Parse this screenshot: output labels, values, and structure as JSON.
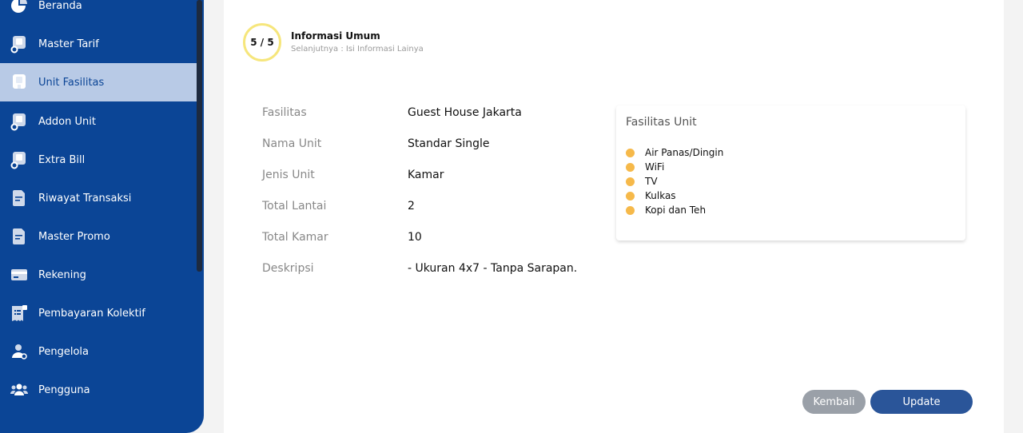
{
  "sidebar": {
    "items": [
      {
        "label": "Beranda",
        "icon": "pie-chart-icon"
      },
      {
        "label": "Master Tarif",
        "icon": "building-settings-icon"
      },
      {
        "label": "Unit Fasilitas",
        "icon": "building-icon"
      },
      {
        "label": "Addon Unit",
        "icon": "building-settings-icon"
      },
      {
        "label": "Extra Bill",
        "icon": "building-settings-icon"
      },
      {
        "label": "Riwayat Transaksi",
        "icon": "document-icon"
      },
      {
        "label": "Master Promo",
        "icon": "document-icon"
      },
      {
        "label": "Rekening",
        "icon": "card-icon"
      },
      {
        "label": "Pembayaran Kolektif",
        "icon": "receipt-icon"
      },
      {
        "label": "Pengelola",
        "icon": "user-settings-icon"
      },
      {
        "label": "Pengguna",
        "icon": "users-icon"
      }
    ],
    "active_index": 2,
    "colors": {
      "bg": "#0b4596",
      "active_bg": "#b8cae6"
    }
  },
  "step": {
    "counter": "5 / 5",
    "title": "Informasi Umum",
    "subtitle": "Selanjutnya : Isi Informasi Lainya"
  },
  "details": [
    {
      "label": "Fasilitas",
      "value": "Guest House Jakarta"
    },
    {
      "label": "Nama Unit",
      "value": "Standar Single"
    },
    {
      "label": "Jenis Unit",
      "value": "Kamar"
    },
    {
      "label": "Total Lantai",
      "value": "2"
    },
    {
      "label": "Total Kamar",
      "value": "10"
    },
    {
      "label": "Deskripsi",
      "value": "- Ukuran 4x7 - Tanpa Sarapan."
    }
  ],
  "facilities": {
    "title": "Fasilitas Unit",
    "items": [
      "Air Panas/Dingin",
      "WiFi",
      "TV",
      "Kulkas",
      "Kopi dan Teh"
    ],
    "dot_color": "#f6b94a"
  },
  "buttons": {
    "back": "Kembali",
    "update": "Update"
  }
}
